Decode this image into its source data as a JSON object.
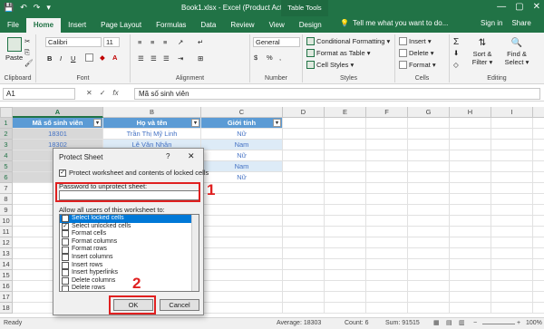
{
  "window": {
    "title": "Book1.xlsx - Excel (Product Activation Failed)",
    "table_tools": "Table Tools",
    "minimize": "—",
    "maximize": "▢",
    "close": "✕"
  },
  "ribbon_tabs": [
    "File",
    "Home",
    "Insert",
    "Page Layout",
    "Formulas",
    "Data",
    "Review",
    "View",
    "Design"
  ],
  "tell_me": "Tell me what you want to do...",
  "sign_in": "Sign in",
  "share": "Share",
  "ribbon": {
    "paste": "Paste",
    "clipboard": "Clipboard",
    "font_name": "Calibri",
    "font_size": "11",
    "font": "Font",
    "bold": "B",
    "italic": "I",
    "underline": "U",
    "alignment": "Alignment",
    "number_format": "General",
    "number": "Number",
    "conditional_formatting": "Conditional Formatting ▾",
    "format_as_table": "Format as Table ▾",
    "cell_styles": "Cell Styles ▾",
    "styles": "Styles",
    "insert": "Insert ▾",
    "delete": "Delete ▾",
    "format": "Format ▾",
    "cells": "Cells",
    "sum": "Σ",
    "sort_filter": "Sort & Filter ▾",
    "find_select": "Find & Select ▾",
    "editing": "Editing"
  },
  "formula_bar": {
    "name_box": "A1",
    "cancel": "✕",
    "enter": "✓",
    "fx": "fx",
    "content": "Mã số sinh viên"
  },
  "columns": [
    "A",
    "B",
    "C",
    "D",
    "E",
    "F",
    "G",
    "H",
    "I",
    "J"
  ],
  "rows": [
    "1",
    "2",
    "3",
    "4",
    "5",
    "6",
    "7",
    "8",
    "9",
    "10",
    "11",
    "12",
    "13",
    "14",
    "15",
    "16",
    "17",
    "18"
  ],
  "table": {
    "headers": [
      "Mã số sinh viên",
      "Họ và tên",
      "Giới tính"
    ],
    "rows": [
      [
        "18301",
        "Trần Thị Mỹ Linh",
        "Nữ"
      ],
      [
        "18302",
        "Lê Văn Nhân",
        "Nam"
      ],
      [
        "",
        "",
        "Nữ"
      ],
      [
        "",
        "",
        "Nam"
      ],
      [
        "",
        "",
        "Nữ"
      ]
    ]
  },
  "dialog": {
    "title": "Protect Sheet",
    "help": "?",
    "close": "✕",
    "protect_label": "Protect worksheet and contents of locked cells",
    "password_label": "Password to unprotect sheet:",
    "password_value": "",
    "allow_label": "Allow all users of this worksheet to:",
    "permissions": [
      {
        "label": "Select locked cells",
        "checked": true
      },
      {
        "label": "Select unlocked cells",
        "checked": true
      },
      {
        "label": "Format cells",
        "checked": false
      },
      {
        "label": "Format columns",
        "checked": false
      },
      {
        "label": "Format rows",
        "checked": false
      },
      {
        "label": "Insert columns",
        "checked": false
      },
      {
        "label": "Insert rows",
        "checked": false
      },
      {
        "label": "Insert hyperlinks",
        "checked": false
      },
      {
        "label": "Delete columns",
        "checked": false
      },
      {
        "label": "Delete rows",
        "checked": false
      }
    ],
    "ok": "OK",
    "cancel": "Cancel"
  },
  "annotations": {
    "step1": "1",
    "step2": "2"
  },
  "status": {
    "ready": "Ready",
    "average": "Average: 18303",
    "count": "Count: 6",
    "sum": "Sum: 91515",
    "zoom": "100%"
  }
}
